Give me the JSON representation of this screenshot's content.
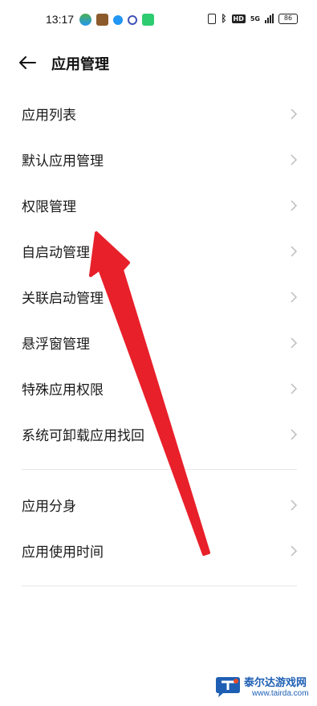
{
  "status_bar": {
    "time": "13:17",
    "hd_label": "HD",
    "network_label": "5G",
    "battery": "86"
  },
  "header": {
    "title": "应用管理"
  },
  "menu": {
    "group1": [
      {
        "label": "应用列表"
      },
      {
        "label": "默认应用管理"
      },
      {
        "label": "权限管理"
      },
      {
        "label": "自启动管理"
      },
      {
        "label": "关联启动管理"
      },
      {
        "label": "悬浮窗管理"
      },
      {
        "label": "特殊应用权限"
      },
      {
        "label": "系统可卸载应用找回"
      }
    ],
    "group2": [
      {
        "label": "应用分身"
      },
      {
        "label": "应用使用时间"
      }
    ]
  },
  "annotation": {
    "arrow_color": "#e8202a"
  },
  "watermark": {
    "title": "泰尔达游戏网",
    "url": "www.tairda.com"
  }
}
